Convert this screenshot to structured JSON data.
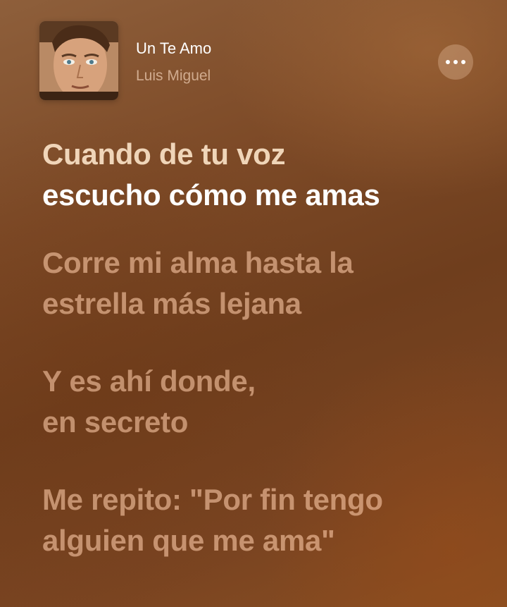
{
  "now_playing": {
    "title": "Un Te Amo",
    "artist": "Luis Miguel",
    "album_art_icon": "album-cover-portrait",
    "more_button_icon": "ellipsis-icon"
  },
  "lyrics": {
    "verses": [
      {
        "lines": [
          "Cuando de tu voz",
          "escucho cómo me amas"
        ],
        "state": "active"
      },
      {
        "lines": [
          "Corre mi alma hasta la",
          "estrella más lejana"
        ],
        "state": "upcoming"
      },
      {
        "lines": [
          "Y es ahí donde,",
          "en secreto"
        ],
        "state": "upcoming"
      },
      {
        "lines": [
          "Me repito: \"Por fin tengo",
          "alguien que me ama\""
        ],
        "state": "upcoming"
      }
    ]
  },
  "colors": {
    "background": "#7d4a27",
    "active_lyric": "#ffffff",
    "inactive_lyric": "#e6b08c"
  }
}
